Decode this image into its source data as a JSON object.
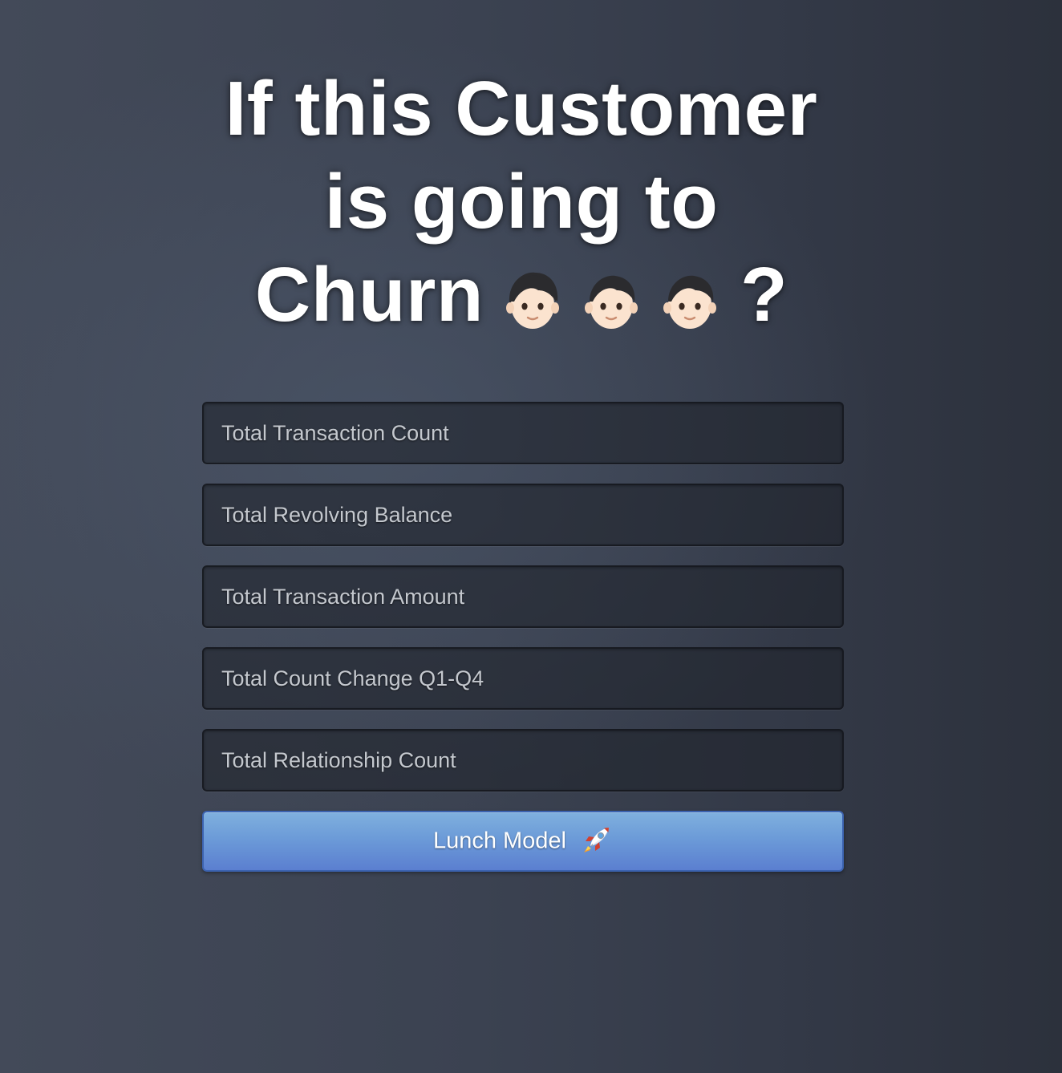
{
  "header": {
    "title_line1": "If this Customer",
    "title_line2": "is going to",
    "title_line3_text": "Churn",
    "title_question_mark": "?",
    "title_emojis": [
      "person-emoji",
      "person-emoji",
      "person-emoji"
    ]
  },
  "form": {
    "fields": [
      {
        "placeholder": "Total Transaction Count"
      },
      {
        "placeholder": "Total Revolving Balance"
      },
      {
        "placeholder": "Total Transaction Amount"
      },
      {
        "placeholder": "Total Count Change Q1-Q4"
      },
      {
        "placeholder": "Total Relationship Count"
      }
    ],
    "submit": {
      "label": "Lunch Model",
      "icon": "rocket-icon"
    }
  },
  "colors": {
    "background_left": "#434a59",
    "background_right": "#2c313c",
    "field_bg": "#262a33",
    "button_top": "#7fb0de",
    "button_bottom": "#5b7fd0",
    "title_text": "#ffffff"
  }
}
